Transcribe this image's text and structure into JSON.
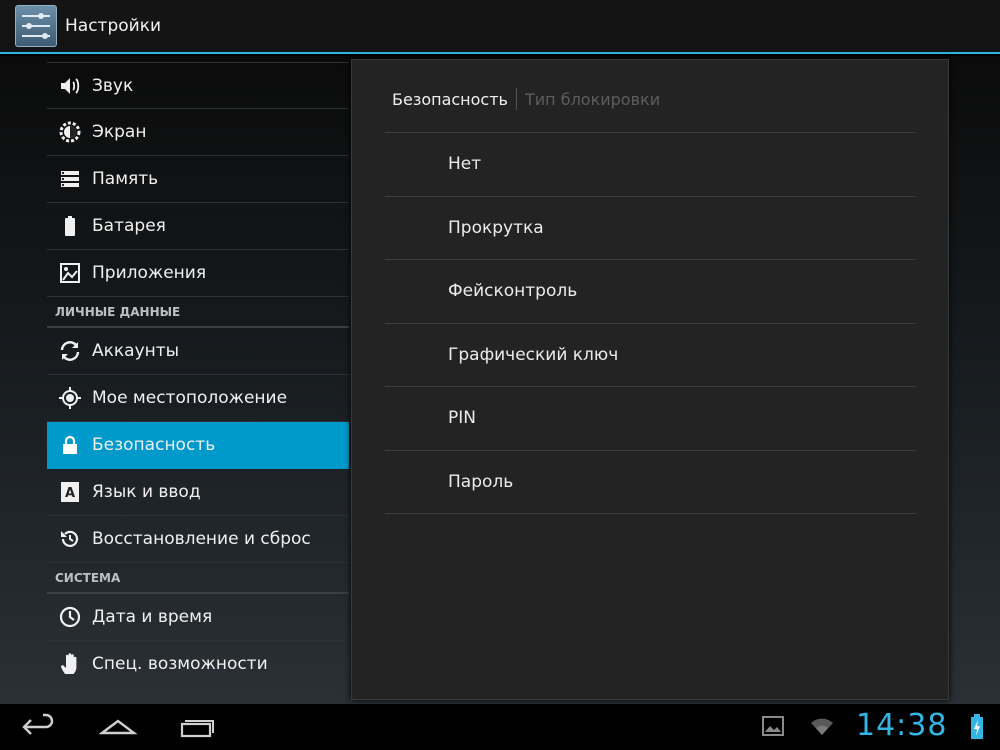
{
  "app": {
    "title": "Настройки",
    "icon": "settings-sliders-icon"
  },
  "left_list": {
    "rows_top": [
      {
        "label": "Звук",
        "icon": "speaker-icon"
      },
      {
        "label": "Экран",
        "icon": "brightness-icon"
      },
      {
        "label": "Память",
        "icon": "storage-icon"
      },
      {
        "label": "Батарея",
        "icon": "battery-icon"
      },
      {
        "label": "Приложения",
        "icon": "apps-icon"
      }
    ],
    "section_personal": "ЛИЧНЫЕ ДАННЫЕ",
    "rows_personal": [
      {
        "label": "Аккаунты",
        "icon": "sync-icon"
      },
      {
        "label": "Мое местоположение",
        "icon": "location-icon"
      },
      {
        "label": "Безопасность",
        "icon": "lock-icon",
        "selected": true
      },
      {
        "label": "Язык и ввод",
        "icon": "language-icon"
      },
      {
        "label": "Восстановление и сброс",
        "icon": "restore-icon"
      }
    ],
    "section_system": "СИСТЕМА",
    "rows_system": [
      {
        "label": "Дата и время",
        "icon": "clock-icon"
      },
      {
        "label": "Спец. возможности",
        "icon": "hand-icon"
      }
    ]
  },
  "panel": {
    "breadcrumb_parent": "Безопасность",
    "breadcrumb_current": "Тип блокировки",
    "options": [
      "Нет",
      "Прокрутка",
      "Фейсконтроль",
      "Графический ключ",
      "PIN",
      "Пароль"
    ]
  },
  "status": {
    "time": "14:38"
  },
  "colors": {
    "accent": "#33b5e5",
    "selected_row": "#0099cc"
  }
}
